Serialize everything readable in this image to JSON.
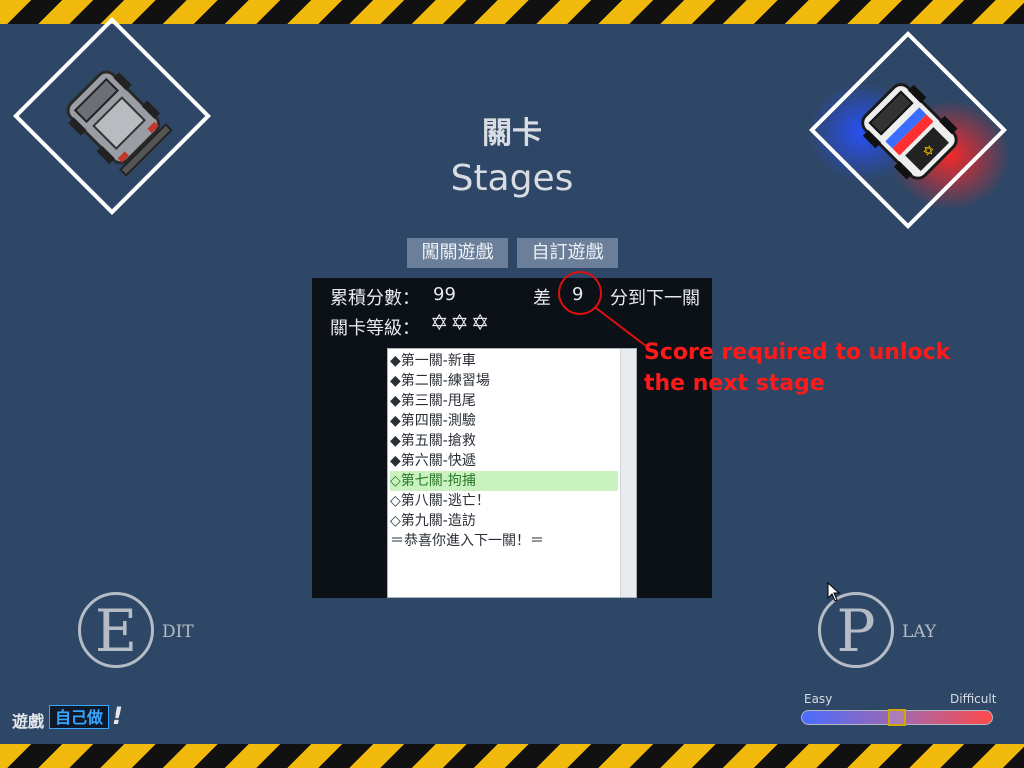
{
  "header": {
    "title_zh": "關卡",
    "title_en": "Stages"
  },
  "tabs": [
    {
      "label": "闖關遊戲"
    },
    {
      "label": "自訂遊戲"
    }
  ],
  "stats": {
    "score_label": "累積分數：",
    "score_value": "99",
    "diff_prefix": "差",
    "diff_value": "9",
    "diff_suffix": "分到下一關",
    "rank_label": "關卡等級：",
    "rank_stars": "✡✡✡"
  },
  "annotation": {
    "line1": "Score required to unlock",
    "line2": "the next stage",
    "color": "#ff1a1a"
  },
  "stage_list": {
    "items": [
      {
        "label": "◆第一關-新車"
      },
      {
        "label": "◆第二關-練習場"
      },
      {
        "label": "◆第三關-甩尾"
      },
      {
        "label": "◆第四關-測驗"
      },
      {
        "label": "◆第五關-搶救"
      },
      {
        "label": "◆第六關-快遞"
      },
      {
        "label": "◇第七關-拘捕",
        "selected": true
      },
      {
        "label": "◇第八關-逃亡！"
      },
      {
        "label": "◇第九關-造訪"
      },
      {
        "label": "＝恭喜你進入下一關！＝"
      }
    ]
  },
  "edit": {
    "letter": "E",
    "word": "DIT"
  },
  "play": {
    "letter": "P",
    "word": "LAY"
  },
  "brand": {
    "part1": "遊戲",
    "part2": "自己做",
    "part3": "!"
  },
  "difficulty": {
    "easy_label": "Easy",
    "hard_label": "Difficult",
    "level": 0.5
  },
  "colors": {
    "background": "#2e4766",
    "hazard_yellow": "#f2b90d",
    "selected_row": "#c9f2c0",
    "annotation_red": "#ff1a1a"
  },
  "icons": [
    "grey-car-icon",
    "police-car-icon",
    "mouse-cursor-icon"
  ]
}
